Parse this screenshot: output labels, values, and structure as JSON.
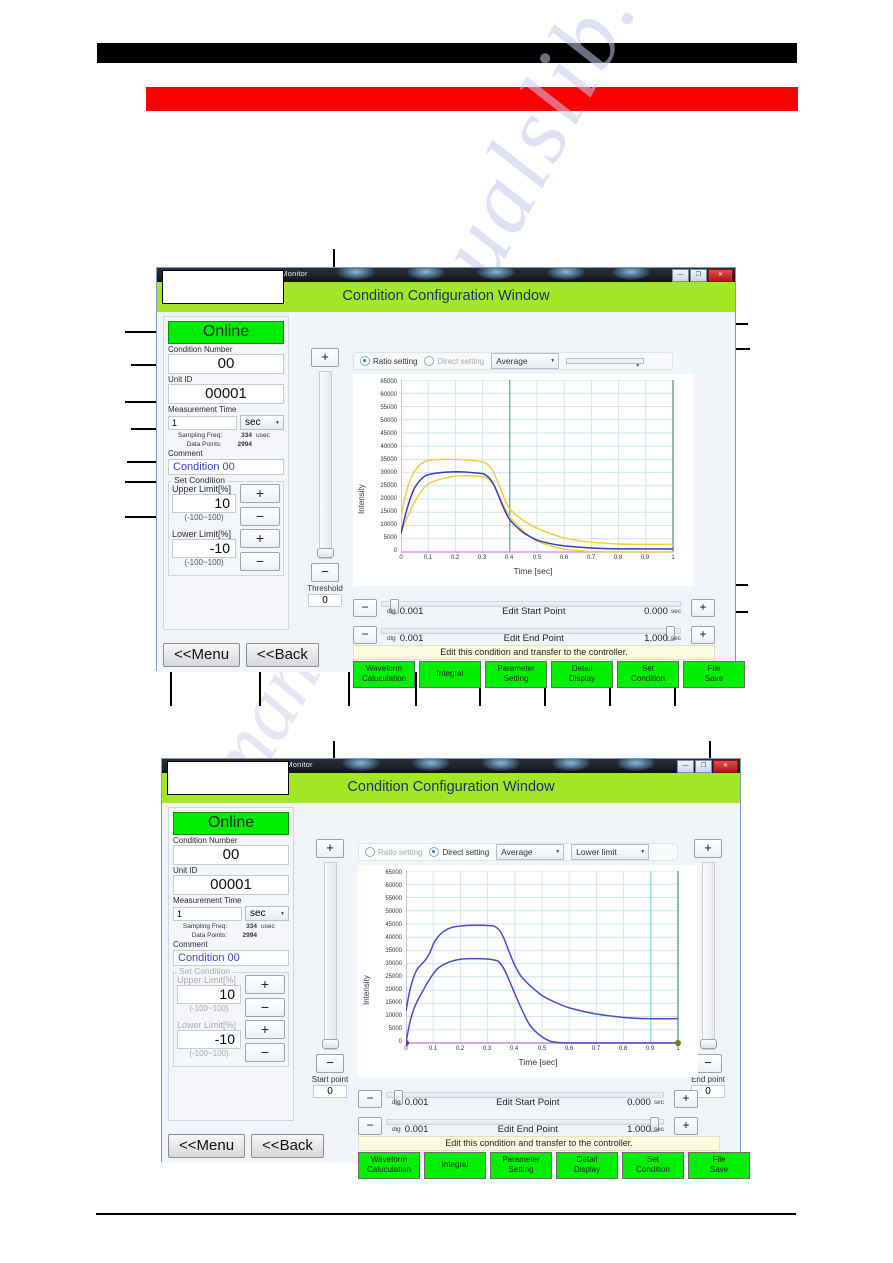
{
  "page": {
    "watermark_text": "manualslib.com",
    "watermark_text2": "manualslib"
  },
  "window": {
    "app_title": "300A Laser Weld Monitor",
    "header_title": "Condition Configuration Window",
    "win_buttons": {
      "minimize": "—",
      "maximize": "❐",
      "close": "✕"
    }
  },
  "left_panel": {
    "status": "Online",
    "condition_number_label": "Condition Number",
    "condition_number_value": "00",
    "unit_id_label": "Unit ID",
    "unit_id_value": "00001",
    "measurement_time_label": "Measurement Time",
    "measurement_time_value": "1",
    "measurement_time_unit": "sec",
    "sampling_freq_label": "Sampling Freq:",
    "sampling_freq_value": "334",
    "sampling_freq_unit": "usec",
    "data_points_label": "Data Points:",
    "data_points_value": "2994",
    "comment_label": "Comment",
    "comment_value": "Condition 00",
    "set_condition_legend": "Set Condition",
    "upper_limit_label": "Upper Limit[%]",
    "upper_limit_value": "10",
    "upper_limit_range": "(-100~100)",
    "lower_limit_label": "Lower Limit[%]",
    "lower_limit_value": "-10",
    "lower_limit_range": "(-100~100)",
    "plus": "+",
    "minus": "−",
    "menu_button": "<<Menu",
    "back_button": "<<Back"
  },
  "options_bar_1": {
    "ratio_setting": "Ratio setting",
    "direct_setting": "Direct setting",
    "ratio_selected": true,
    "dropdown_mode": "Average",
    "dropdown_limit": ""
  },
  "options_bar_2": {
    "ratio_setting": "Ratio setting",
    "direct_setting": "Direct setting",
    "ratio_selected": false,
    "dropdown_mode": "Average",
    "dropdown_limit": "Lower limit"
  },
  "slider_left_1": {
    "plus": "+",
    "minus": "−",
    "label": "Threshold",
    "value": "0"
  },
  "slider_left_2": {
    "plus": "+",
    "minus": "−",
    "label": "Start point",
    "value": "0"
  },
  "slider_right_2": {
    "plus": "+",
    "minus": "−",
    "label": "End point",
    "value": "0"
  },
  "edit_points": {
    "minus": "−",
    "plus": "+",
    "dig_label": "dig",
    "dig_value": "0.001",
    "start_name": "Edit Start Point",
    "start_value": "0.000",
    "start_unit": "sec",
    "end_name": "Edit End Point",
    "end_value": "1.000",
    "end_unit": "sec",
    "hint": "Edit this condition and transfer to the controller."
  },
  "function_buttons": [
    {
      "line1": "Waveform",
      "line2": "Caluculation"
    },
    {
      "line1": "Integral",
      "line2": ""
    },
    {
      "line1": "Parameter",
      "line2": "Setting"
    },
    {
      "line1": "Detail",
      "line2": "Display"
    },
    {
      "line1": "Set",
      "line2": "Condition"
    },
    {
      "line1": "File",
      "line2": "Save"
    }
  ],
  "chart_data": [
    {
      "type": "line",
      "title": "",
      "xlabel": "Time [sec]",
      "ylabel": "Intensity",
      "xlim": [
        0,
        1
      ],
      "ylim": [
        0,
        65000
      ],
      "grid": true,
      "legend": "none",
      "xticks": [
        "0",
        "0.1",
        "0.2",
        "0.3",
        "0.4",
        "0.5",
        "0.6",
        "0.7",
        "0.8",
        "0.9",
        "1"
      ],
      "yticks": [
        "0",
        "5000",
        "10000",
        "15000",
        "20000",
        "25000",
        "30000",
        "35000",
        "40000",
        "45000",
        "50000",
        "55000",
        "60000",
        "65000"
      ],
      "x": [
        0,
        0.05,
        0.1,
        0.15,
        0.2,
        0.25,
        0.3,
        0.35,
        0.4,
        0.45,
        0.5,
        0.55,
        0.6,
        0.65,
        0.7,
        0.75,
        0.8,
        0.85,
        0.9,
        0.95,
        1
      ],
      "series": [
        {
          "name": "upper limit",
          "color": "#f2cb3a",
          "values": [
            13500,
            26500,
            30600,
            32100,
            32200,
            32000,
            31800,
            29000,
            21500,
            17000,
            14500,
            12800,
            11700,
            11000,
            10500,
            10100,
            9900,
            9800,
            9750,
            9730,
            9720
          ]
        },
        {
          "name": "average",
          "color": "#3a3ac0",
          "values": [
            6900,
            19000,
            23900,
            25400,
            25600,
            25500,
            25100,
            22000,
            15200,
            11200,
            8800,
            6900,
            5700,
            4900,
            4400,
            4100,
            3800,
            3600,
            3500,
            3450,
            3420
          ]
        },
        {
          "name": "lower limit",
          "color": "#f2cb3a",
          "values": [
            300,
            13000,
            17800,
            19000,
            19200,
            19100,
            18700,
            15000,
            9500,
            5800,
            3200,
            1300,
            200,
            0,
            0,
            0,
            0,
            0,
            0,
            0,
            0
          ]
        }
      ]
    },
    {
      "type": "line",
      "title": "",
      "xlabel": "Time [sec]",
      "ylabel": "Intensity",
      "xlim": [
        0,
        1
      ],
      "ylim": [
        0,
        65000
      ],
      "grid": true,
      "legend": "none",
      "xticks": [
        "0",
        "0.1",
        "0.2",
        "0.3",
        "0.4",
        "0.5",
        "0.6",
        "0.7",
        "0.8",
        "0.9",
        "1"
      ],
      "yticks": [
        "0",
        "5000",
        "10000",
        "15000",
        "20000",
        "25000",
        "30000",
        "35000",
        "40000",
        "45000",
        "50000",
        "55000",
        "60000",
        "65000"
      ],
      "x": [
        0,
        0.05,
        0.1,
        0.15,
        0.2,
        0.25,
        0.3,
        0.35,
        0.4,
        0.45,
        0.5,
        0.55,
        0.6,
        0.65,
        0.7,
        0.75,
        0.8,
        0.85,
        0.9,
        0.95,
        1
      ],
      "series": [
        {
          "name": "upper limit",
          "color": "#4a4ac8",
          "values": [
            12000,
            29000,
            37500,
            40400,
            40900,
            40900,
            40700,
            38000,
            30000,
            22500,
            18500,
            16300,
            14800,
            13700,
            13000,
            12500,
            12200,
            11950,
            11750,
            11600,
            11500
          ]
        },
        {
          "name": "lower limit",
          "color": "#4a4ac8",
          "values": [
            0,
            13500,
            23500,
            26900,
            27900,
            27800,
            27500,
            24500,
            17000,
            10000,
            5200,
            2500,
            900,
            200,
            0,
            0,
            0,
            0,
            0,
            0,
            0
          ]
        }
      ],
      "markers": [
        {
          "x": 0,
          "y": 0,
          "color": "#7a2fa0",
          "name": "start-marker"
        },
        {
          "x": 1,
          "y": 0,
          "color": "#5a8a1a",
          "name": "end-marker"
        }
      ]
    }
  ]
}
